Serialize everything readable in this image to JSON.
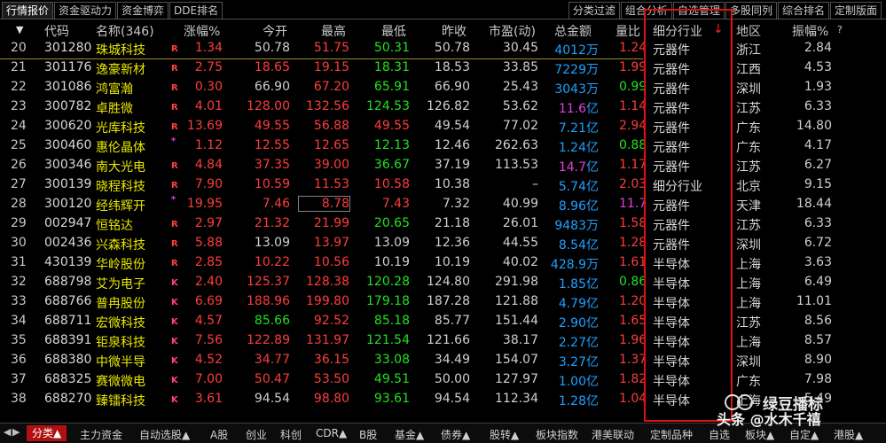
{
  "top_tabs_left": [
    "行情报价",
    "资金驱动力",
    "资金博弈",
    "DDE排名"
  ],
  "top_tabs_right": [
    "分类过滤",
    "组合分析",
    "自选管理",
    "多股同列",
    "综合排名",
    "定制版面"
  ],
  "columns": {
    "sort": "▼",
    "code": "代码",
    "name": "名称(346)",
    "chg": "涨幅%",
    "open": "今开",
    "high": "最高",
    "low": "最低",
    "prev": "昨收",
    "pe": "市盈(动)",
    "amount": "总金额",
    "ratio": "量比",
    "industry": "细分行业",
    "industry_arrow": "↓",
    "region": "地区",
    "amp": "振幅%",
    "help": "?"
  },
  "rows": [
    {
      "idx": "20",
      "code": "301280",
      "name": "珠城科技",
      "badge": "R",
      "chg": "1.34",
      "open": "50.78",
      "high": "51.75",
      "low": "50.31",
      "prev": "50.78",
      "pe": "30.45",
      "amt": "4012",
      "unit": "万",
      "ratio": "1.24",
      "ind": "元器件",
      "region": "浙江",
      "amp": "2.84",
      "chg_c": "up",
      "open_c": "flat",
      "high_c": "up",
      "low_c": "down",
      "amt_c": "blue",
      "ratio_c": "up"
    },
    {
      "idx": "21",
      "code": "301176",
      "name": "逸豪新材",
      "badge": "R",
      "chg": "2.75",
      "open": "18.65",
      "high": "19.15",
      "low": "18.31",
      "prev": "18.53",
      "pe": "33.85",
      "amt": "7229",
      "unit": "万",
      "ratio": "1.99",
      "ind": "元器件",
      "region": "江西",
      "amp": "4.53",
      "chg_c": "up",
      "open_c": "up",
      "high_c": "up",
      "low_c": "down",
      "amt_c": "blue",
      "ratio_c": "up"
    },
    {
      "idx": "22",
      "code": "301086",
      "name": "鸿富瀚",
      "badge": "R",
      "chg": "0.30",
      "open": "66.90",
      "high": "67.20",
      "low": "65.91",
      "prev": "66.90",
      "pe": "25.43",
      "amt": "3043",
      "unit": "万",
      "ratio": "0.99",
      "ind": "元器件",
      "region": "深圳",
      "amp": "1.93",
      "chg_c": "up",
      "open_c": "flat",
      "high_c": "up",
      "low_c": "down",
      "amt_c": "blue",
      "ratio_c": "down"
    },
    {
      "idx": "23",
      "code": "300782",
      "name": "卓胜微",
      "badge": "R",
      "chg": "4.01",
      "open": "128.00",
      "high": "132.56",
      "low": "124.53",
      "prev": "126.82",
      "pe": "53.62",
      "amt": "11.6",
      "unit": "亿",
      "ratio": "1.14",
      "ind": "元器件",
      "region": "江苏",
      "amp": "6.33",
      "chg_c": "up",
      "open_c": "up",
      "high_c": "up",
      "low_c": "down",
      "amt_c": "mag",
      "ratio_c": "up"
    },
    {
      "idx": "24",
      "code": "300620",
      "name": "光库科技",
      "badge": "R",
      "chg": "13.69",
      "open": "49.55",
      "high": "56.88",
      "low": "49.55",
      "prev": "49.54",
      "pe": "77.02",
      "amt": "7.21",
      "unit": "亿",
      "ratio": "2.94",
      "ind": "元器件",
      "region": "广东",
      "amp": "14.80",
      "chg_c": "up",
      "open_c": "up",
      "high_c": "up",
      "low_c": "up",
      "amt_c": "blue",
      "ratio_c": "up"
    },
    {
      "idx": "25",
      "code": "300460",
      "name": "惠伦晶体",
      "badge": "*",
      "chg": "1.12",
      "open": "12.55",
      "high": "12.65",
      "low": "12.13",
      "prev": "12.46",
      "pe": "262.63",
      "amt": "1.24",
      "unit": "亿",
      "ratio": "0.88",
      "ind": "元器件",
      "region": "广东",
      "amp": "4.17",
      "chg_c": "up",
      "open_c": "up",
      "high_c": "up",
      "low_c": "down",
      "amt_c": "blue",
      "ratio_c": "down"
    },
    {
      "idx": "26",
      "code": "300346",
      "name": "南大光电",
      "badge": "R",
      "chg": "4.84",
      "open": "37.35",
      "high": "39.00",
      "low": "36.67",
      "prev": "37.19",
      "pe": "113.53",
      "amt": "14.7",
      "unit": "亿",
      "ratio": "1.17",
      "ind": "元器件",
      "region": "江苏",
      "amp": "6.27",
      "chg_c": "up",
      "open_c": "up",
      "high_c": "up",
      "low_c": "down",
      "amt_c": "mag",
      "ratio_c": "up"
    },
    {
      "idx": "27",
      "code": "300139",
      "name": "晓程科技",
      "badge": "R",
      "chg": "7.90",
      "open": "10.59",
      "high": "11.53",
      "low": "10.58",
      "prev": "10.38",
      "pe": "–",
      "amt": "5.74",
      "unit": "亿",
      "ratio": "2.03",
      "ind": "细分行业",
      "region": "北京",
      "amp": "9.15",
      "chg_c": "up",
      "open_c": "up",
      "high_c": "up",
      "low_c": "up",
      "amt_c": "blue",
      "ratio_c": "up"
    },
    {
      "idx": "28",
      "code": "300120",
      "name": "经纬辉开",
      "badge": "*",
      "chg": "19.95",
      "open": "7.46",
      "high": "8.78",
      "low": "7.43",
      "prev": "7.32",
      "pe": "40.99",
      "amt": "8.96",
      "unit": "亿",
      "ratio": "11.79",
      "ind": "元器件",
      "region": "天津",
      "amp": "18.44",
      "chg_c": "up",
      "open_c": "up",
      "high_c": "up",
      "low_c": "up",
      "amt_c": "blue",
      "ratio_c": "mag",
      "highlight": true
    },
    {
      "idx": "29",
      "code": "002947",
      "name": "恒铭达",
      "badge": "R",
      "chg": "2.97",
      "open": "21.32",
      "high": "21.99",
      "low": "20.65",
      "prev": "21.18",
      "pe": "26.01",
      "amt": "9483",
      "unit": "万",
      "ratio": "1.58",
      "ind": "元器件",
      "region": "江苏",
      "amp": "6.33",
      "chg_c": "up",
      "open_c": "up",
      "high_c": "up",
      "low_c": "down",
      "amt_c": "blue",
      "ratio_c": "up"
    },
    {
      "idx": "30",
      "code": "002436",
      "name": "兴森科技",
      "badge": "R",
      "chg": "5.88",
      "open": "13.09",
      "high": "13.97",
      "low": "13.09",
      "prev": "12.36",
      "pe": "44.55",
      "amt": "8.54",
      "unit": "亿",
      "ratio": "1.28",
      "ind": "元器件",
      "region": "深圳",
      "amp": "6.72",
      "chg_c": "up",
      "open_c": "flat",
      "high_c": "up",
      "low_c": "flat",
      "amt_c": "blue",
      "ratio_c": "up"
    },
    {
      "idx": "31",
      "code": "430139",
      "name": "华岭股份",
      "badge": "R",
      "chg": "2.85",
      "open": "10.22",
      "high": "10.56",
      "low": "10.19",
      "prev": "10.19",
      "pe": "40.02",
      "amt": "428.9",
      "unit": "万",
      "ratio": "1.61",
      "ind": "半导体",
      "region": "上海",
      "amp": "3.63",
      "chg_c": "up",
      "open_c": "up",
      "high_c": "up",
      "low_c": "flat",
      "amt_c": "blue",
      "ratio_c": "up"
    },
    {
      "idx": "32",
      "code": "688798",
      "name": "艾为电子",
      "badge": "K",
      "chg": "2.40",
      "open": "125.37",
      "high": "128.38",
      "low": "120.28",
      "prev": "124.80",
      "pe": "291.98",
      "amt": "1.85",
      "unit": "亿",
      "ratio": "0.86",
      "ind": "半导体",
      "region": "上海",
      "amp": "6.49",
      "chg_c": "up",
      "open_c": "up",
      "high_c": "up",
      "low_c": "down",
      "amt_c": "blue",
      "ratio_c": "down"
    },
    {
      "idx": "33",
      "code": "688766",
      "name": "普冉股份",
      "badge": "K",
      "chg": "6.69",
      "open": "188.96",
      "high": "199.80",
      "low": "179.18",
      "prev": "187.28",
      "pe": "121.88",
      "amt": "4.79",
      "unit": "亿",
      "ratio": "1.20",
      "ind": "半导体",
      "region": "上海",
      "amp": "11.01",
      "chg_c": "up",
      "open_c": "up",
      "high_c": "up",
      "low_c": "down",
      "amt_c": "blue",
      "ratio_c": "up"
    },
    {
      "idx": "34",
      "code": "688711",
      "name": "宏微科技",
      "badge": "K",
      "chg": "4.57",
      "open": "85.66",
      "high": "92.52",
      "low": "85.18",
      "prev": "85.77",
      "pe": "151.44",
      "amt": "2.90",
      "unit": "亿",
      "ratio": "1.65",
      "ind": "半导体",
      "region": "江苏",
      "amp": "8.56",
      "chg_c": "up",
      "open_c": "down",
      "high_c": "up",
      "low_c": "down",
      "amt_c": "blue",
      "ratio_c": "up"
    },
    {
      "idx": "35",
      "code": "688391",
      "name": "钜泉科技",
      "badge": "K",
      "chg": "7.56",
      "open": "122.89",
      "high": "131.97",
      "low": "121.54",
      "prev": "121.66",
      "pe": "38.17",
      "amt": "2.27",
      "unit": "亿",
      "ratio": "1.96",
      "ind": "半导体",
      "region": "上海",
      "amp": "8.57",
      "chg_c": "up",
      "open_c": "up",
      "high_c": "up",
      "low_c": "down",
      "amt_c": "blue",
      "ratio_c": "up"
    },
    {
      "idx": "36",
      "code": "688380",
      "name": "中微半导",
      "badge": "K",
      "chg": "4.52",
      "open": "34.77",
      "high": "36.15",
      "low": "33.08",
      "prev": "34.49",
      "pe": "154.07",
      "amt": "3.27",
      "unit": "亿",
      "ratio": "1.37",
      "ind": "半导体",
      "region": "深圳",
      "amp": "8.90",
      "chg_c": "up",
      "open_c": "up",
      "high_c": "up",
      "low_c": "down",
      "amt_c": "blue",
      "ratio_c": "up"
    },
    {
      "idx": "37",
      "code": "688325",
      "name": "赛微微电",
      "badge": "K",
      "chg": "7.00",
      "open": "50.47",
      "high": "53.50",
      "low": "49.51",
      "prev": "50.00",
      "pe": "127.97",
      "amt": "1.00",
      "unit": "亿",
      "ratio": "1.82",
      "ind": "半导体",
      "region": "广东",
      "amp": "7.98",
      "chg_c": "up",
      "open_c": "up",
      "high_c": "up",
      "low_c": "down",
      "amt_c": "blue",
      "ratio_c": "up"
    },
    {
      "idx": "38",
      "code": "688270",
      "name": "臻镭科技",
      "badge": "K",
      "chg": "3.61",
      "open": "94.54",
      "high": "98.80",
      "low": "93.61",
      "prev": "94.54",
      "pe": "112.34",
      "amt": "1.28",
      "unit": "亿",
      "ratio": "1.04",
      "ind": "半导体",
      "region": "上海",
      "amp": "5.49",
      "chg_c": "up",
      "open_c": "flat",
      "high_c": "up",
      "low_c": "down",
      "amt_c": "blue",
      "ratio_c": "up"
    }
  ],
  "bottom_tabs": [
    "分类▲",
    "主力资金",
    "自动选股▲",
    "A股",
    "创业",
    "科创",
    "CDR▲",
    "B股",
    "基金▲",
    "债券▲",
    "股转▲",
    "板块指数",
    "港美联动",
    "定制品种",
    "自选",
    "板块▲",
    "自定▲",
    "港股▲"
  ],
  "watermark": {
    "line1": "绿豆播标",
    "line2": "头条 @水木千禧"
  },
  "colors": {
    "up": "#ff3c3c",
    "down": "#22e022",
    "flat": "#d0d0d0",
    "blue": "#1ea0ff",
    "mag": "#e040e0",
    "yellow": "#e8e800",
    "cyan": "#40e0e0",
    "badgeR": "#ff4040",
    "badgeK": "#ff4080",
    "badgeStar": "#e040e0"
  }
}
